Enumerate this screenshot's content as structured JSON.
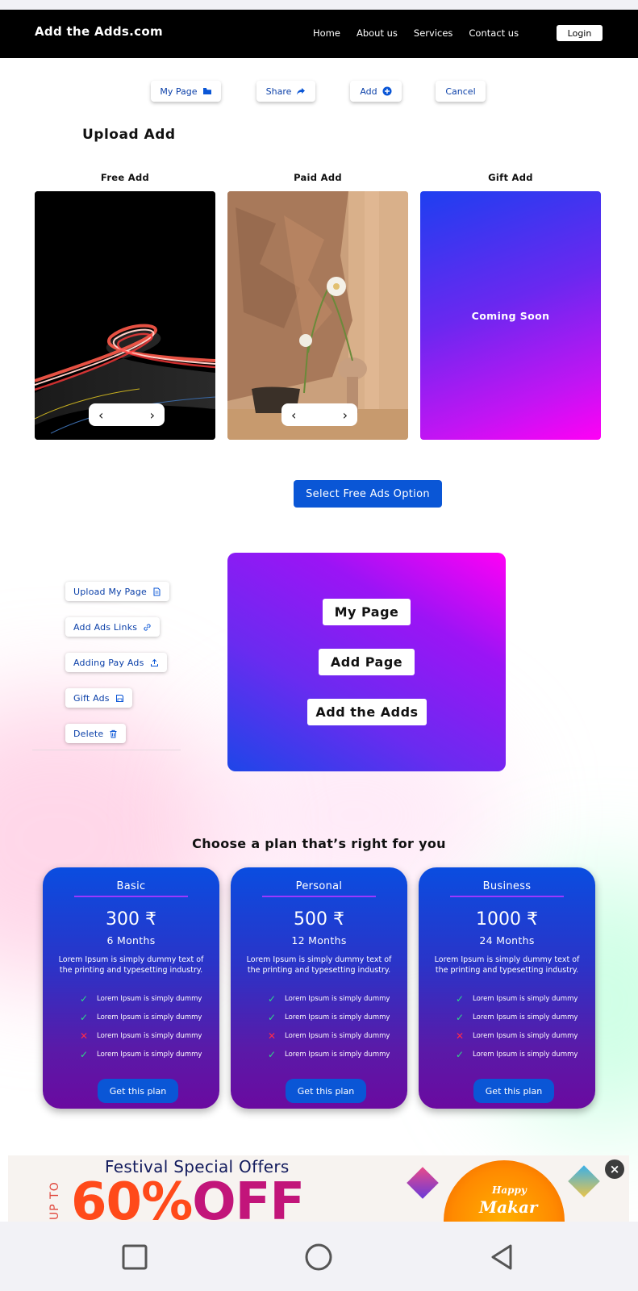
{
  "brand": "Add the Adds.com",
  "nav": {
    "links": [
      "Home",
      "About us",
      "Services",
      "Contact us"
    ],
    "login": "Login"
  },
  "actions": {
    "my_page": "My Page",
    "share": "Share",
    "add": "Add",
    "cancel": "Cancel"
  },
  "upload": {
    "title": "Upload Add",
    "columns": [
      "Free Add",
      "Paid Add",
      "Gift Add"
    ],
    "gift_text": "Coming Soon",
    "pager_prev": "‹",
    "pager_next": "›",
    "select_button": "Select Free Ads Option"
  },
  "side_menu": {
    "items": [
      "Upload My Page",
      "Add Ads Links",
      "Adding Pay Ads",
      "Gift Ads",
      "Delete"
    ]
  },
  "panel": {
    "buttons": [
      "My Page",
      "Add Page",
      "Add the Adds"
    ]
  },
  "plans": {
    "heading": "Choose a plan that’s right for you",
    "items": [
      {
        "name": "Basic",
        "price": "300 ₹",
        "duration": "6 Months",
        "description": "Lorem Ipsum is simply dummy text of the printing and typesetting industry.",
        "features": [
          {
            "text": "Lorem Ipsum is simply dummy",
            "included": true
          },
          {
            "text": "Lorem Ipsum is simply dummy",
            "included": true
          },
          {
            "text": "Lorem Ipsum is simply dummy",
            "included": false
          },
          {
            "text": "Lorem Ipsum is simply dummy",
            "included": true
          }
        ],
        "button": "Get this plan"
      },
      {
        "name": "Personal",
        "price": "500 ₹",
        "duration": "12 Months",
        "description": "Lorem Ipsum is simply dummy text of the printing and typesetting industry.",
        "features": [
          {
            "text": "Lorem Ipsum is simply dummy",
            "included": true
          },
          {
            "text": "Lorem Ipsum is simply dummy",
            "included": true
          },
          {
            "text": "Lorem Ipsum is simply dummy",
            "included": false
          },
          {
            "text": "Lorem Ipsum is simply dummy",
            "included": true
          }
        ],
        "button": "Get this plan"
      },
      {
        "name": "Business",
        "price": "1000 ₹",
        "duration": "24 Months",
        "description": "Lorem Ipsum is simply dummy text of the printing and typesetting industry.",
        "features": [
          {
            "text": "Lorem Ipsum is simply dummy",
            "included": true
          },
          {
            "text": "Lorem Ipsum is simply dummy",
            "included": true
          },
          {
            "text": "Lorem Ipsum is simply dummy",
            "included": false
          },
          {
            "text": "Lorem Ipsum is simply dummy",
            "included": true
          }
        ],
        "button": "Get this plan"
      }
    ]
  },
  "banner": {
    "title": "Festival Special Offers",
    "upto": "UP TO",
    "discount_num": "60%",
    "discount_off": "OFF",
    "badge_line1": "Happy",
    "badge_line2": "Makar",
    "close": "×"
  },
  "colors": {
    "accent_blue": "#0a56d6",
    "link_blue": "#0a3fa8",
    "navbar": "#000000",
    "ok_green": "#2dd98a",
    "no_red": "#ff2a4a"
  },
  "icons": {
    "my_page": "folder-icon",
    "share": "share-arrow-icon",
    "add": "plus-circle-icon",
    "upload_my_page": "document-icon",
    "add_ads_links": "link-icon",
    "adding_pay_ads": "upload-icon",
    "gift_ads": "save-icon",
    "delete": "trash-icon"
  }
}
